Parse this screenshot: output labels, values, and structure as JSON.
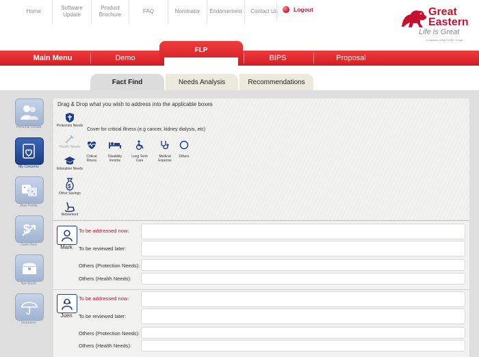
{
  "top_nav": {
    "items": [
      {
        "label": "Home"
      },
      {
        "label": "Software\nUpdate"
      },
      {
        "label": "Product\nBrochure"
      },
      {
        "label": "FAQ"
      },
      {
        "label": "Nominator"
      },
      {
        "label": "Endorsement"
      },
      {
        "label": "Contact Us"
      }
    ],
    "logout": "Logout"
  },
  "brand": {
    "name_line1": "Great",
    "name_line2": "Eastern",
    "tagline": "Life is Great",
    "subtag": "A member of the OCBC Group"
  },
  "main_menu": {
    "title": "Main Menu",
    "items": [
      "Demo",
      "FLP",
      "BIPS",
      "Proposal"
    ],
    "active": "FLP"
  },
  "sub_tabs": {
    "items": [
      "Fact Find",
      "Needs Analysis",
      "Recommendations"
    ],
    "active": "Fact Find"
  },
  "sidebar": {
    "items": [
      {
        "label": "Personal Details",
        "icon": "people-icon"
      },
      {
        "label": "My Concerns",
        "icon": "heart-form-icon",
        "active": true
      },
      {
        "label": "Risk Profile",
        "icon": "dice-icon"
      },
      {
        "label": "Cash Flow",
        "icon": "money-arrow-icon"
      },
      {
        "label": "Net Worth",
        "icon": "chest-icon"
      },
      {
        "label": "Insurance",
        "icon": "umbrella-icon"
      }
    ]
  },
  "concerns": {
    "instruction": "Drag & Drop what you wish to address into the applicable boxes",
    "categories": [
      {
        "label": "Protection Needs",
        "icon": "shield-icon"
      },
      {
        "label": "Health Needs",
        "icon": "syringe-icon"
      },
      {
        "label": "Education Needs",
        "icon": "mortarboard-icon"
      },
      {
        "label": "Other Savings",
        "icon": "moneybag-icon"
      },
      {
        "label": "Retirement",
        "icon": "rocking-chair-icon"
      }
    ],
    "cover_text": "Cover for critical illness (e.g cancer, kidney dialysis, etc)",
    "health_options": [
      {
        "label": "Critical\nIllness",
        "icon": "heart-pulse-icon"
      },
      {
        "label": "Disability\nIncome",
        "icon": "bed-icon"
      },
      {
        "label": "Long Term\nCare",
        "icon": "wheelchair-icon"
      },
      {
        "label": "Medical\nExpense",
        "icon": "stethoscope-icon"
      },
      {
        "label": "Others",
        "icon": "circle-icon"
      }
    ]
  },
  "persons": [
    {
      "name": "Mark",
      "rows": [
        {
          "label": "To be addressed now:",
          "value": ""
        },
        {
          "label": "To be reviewed later:",
          "value": ""
        },
        {
          "label": "Others (Protection Needs):",
          "value": ""
        },
        {
          "label": "Others (Health Needs):",
          "value": ""
        }
      ]
    },
    {
      "name": "Juen",
      "rows": [
        {
          "label": "To be addressed now:",
          "value": ""
        },
        {
          "label": "To be reviewed later:",
          "value": ""
        },
        {
          "label": "Others (Protection Needs):",
          "value": ""
        },
        {
          "label": "Others (Health Needs):",
          "value": ""
        }
      ]
    }
  ],
  "colors": {
    "brand_red": "#c8102e",
    "menu_red": "#e42a2f",
    "sidebar_active": "#1e3d86"
  }
}
